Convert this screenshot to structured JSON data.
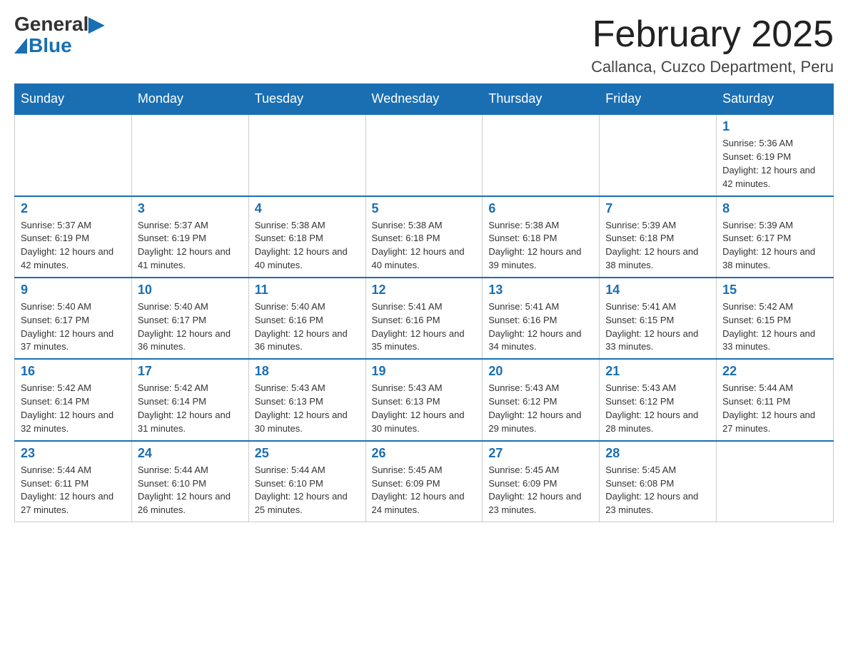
{
  "logo": {
    "general": "General",
    "blue": "Blue",
    "triangle": "▶"
  },
  "title": "February 2025",
  "subtitle": "Callanca, Cuzco Department, Peru",
  "days_of_week": [
    "Sunday",
    "Monday",
    "Tuesday",
    "Wednesday",
    "Thursday",
    "Friday",
    "Saturday"
  ],
  "weeks": [
    [
      {
        "day": "",
        "info": ""
      },
      {
        "day": "",
        "info": ""
      },
      {
        "day": "",
        "info": ""
      },
      {
        "day": "",
        "info": ""
      },
      {
        "day": "",
        "info": ""
      },
      {
        "day": "",
        "info": ""
      },
      {
        "day": "1",
        "info": "Sunrise: 5:36 AM\nSunset: 6:19 PM\nDaylight: 12 hours and 42 minutes."
      }
    ],
    [
      {
        "day": "2",
        "info": "Sunrise: 5:37 AM\nSunset: 6:19 PM\nDaylight: 12 hours and 42 minutes."
      },
      {
        "day": "3",
        "info": "Sunrise: 5:37 AM\nSunset: 6:19 PM\nDaylight: 12 hours and 41 minutes."
      },
      {
        "day": "4",
        "info": "Sunrise: 5:38 AM\nSunset: 6:18 PM\nDaylight: 12 hours and 40 minutes."
      },
      {
        "day": "5",
        "info": "Sunrise: 5:38 AM\nSunset: 6:18 PM\nDaylight: 12 hours and 40 minutes."
      },
      {
        "day": "6",
        "info": "Sunrise: 5:38 AM\nSunset: 6:18 PM\nDaylight: 12 hours and 39 minutes."
      },
      {
        "day": "7",
        "info": "Sunrise: 5:39 AM\nSunset: 6:18 PM\nDaylight: 12 hours and 38 minutes."
      },
      {
        "day": "8",
        "info": "Sunrise: 5:39 AM\nSunset: 6:17 PM\nDaylight: 12 hours and 38 minutes."
      }
    ],
    [
      {
        "day": "9",
        "info": "Sunrise: 5:40 AM\nSunset: 6:17 PM\nDaylight: 12 hours and 37 minutes."
      },
      {
        "day": "10",
        "info": "Sunrise: 5:40 AM\nSunset: 6:17 PM\nDaylight: 12 hours and 36 minutes."
      },
      {
        "day": "11",
        "info": "Sunrise: 5:40 AM\nSunset: 6:16 PM\nDaylight: 12 hours and 36 minutes."
      },
      {
        "day": "12",
        "info": "Sunrise: 5:41 AM\nSunset: 6:16 PM\nDaylight: 12 hours and 35 minutes."
      },
      {
        "day": "13",
        "info": "Sunrise: 5:41 AM\nSunset: 6:16 PM\nDaylight: 12 hours and 34 minutes."
      },
      {
        "day": "14",
        "info": "Sunrise: 5:41 AM\nSunset: 6:15 PM\nDaylight: 12 hours and 33 minutes."
      },
      {
        "day": "15",
        "info": "Sunrise: 5:42 AM\nSunset: 6:15 PM\nDaylight: 12 hours and 33 minutes."
      }
    ],
    [
      {
        "day": "16",
        "info": "Sunrise: 5:42 AM\nSunset: 6:14 PM\nDaylight: 12 hours and 32 minutes."
      },
      {
        "day": "17",
        "info": "Sunrise: 5:42 AM\nSunset: 6:14 PM\nDaylight: 12 hours and 31 minutes."
      },
      {
        "day": "18",
        "info": "Sunrise: 5:43 AM\nSunset: 6:13 PM\nDaylight: 12 hours and 30 minutes."
      },
      {
        "day": "19",
        "info": "Sunrise: 5:43 AM\nSunset: 6:13 PM\nDaylight: 12 hours and 30 minutes."
      },
      {
        "day": "20",
        "info": "Sunrise: 5:43 AM\nSunset: 6:12 PM\nDaylight: 12 hours and 29 minutes."
      },
      {
        "day": "21",
        "info": "Sunrise: 5:43 AM\nSunset: 6:12 PM\nDaylight: 12 hours and 28 minutes."
      },
      {
        "day": "22",
        "info": "Sunrise: 5:44 AM\nSunset: 6:11 PM\nDaylight: 12 hours and 27 minutes."
      }
    ],
    [
      {
        "day": "23",
        "info": "Sunrise: 5:44 AM\nSunset: 6:11 PM\nDaylight: 12 hours and 27 minutes."
      },
      {
        "day": "24",
        "info": "Sunrise: 5:44 AM\nSunset: 6:10 PM\nDaylight: 12 hours and 26 minutes."
      },
      {
        "day": "25",
        "info": "Sunrise: 5:44 AM\nSunset: 6:10 PM\nDaylight: 12 hours and 25 minutes."
      },
      {
        "day": "26",
        "info": "Sunrise: 5:45 AM\nSunset: 6:09 PM\nDaylight: 12 hours and 24 minutes."
      },
      {
        "day": "27",
        "info": "Sunrise: 5:45 AM\nSunset: 6:09 PM\nDaylight: 12 hours and 23 minutes."
      },
      {
        "day": "28",
        "info": "Sunrise: 5:45 AM\nSunset: 6:08 PM\nDaylight: 12 hours and 23 minutes."
      },
      {
        "day": "",
        "info": ""
      }
    ]
  ]
}
